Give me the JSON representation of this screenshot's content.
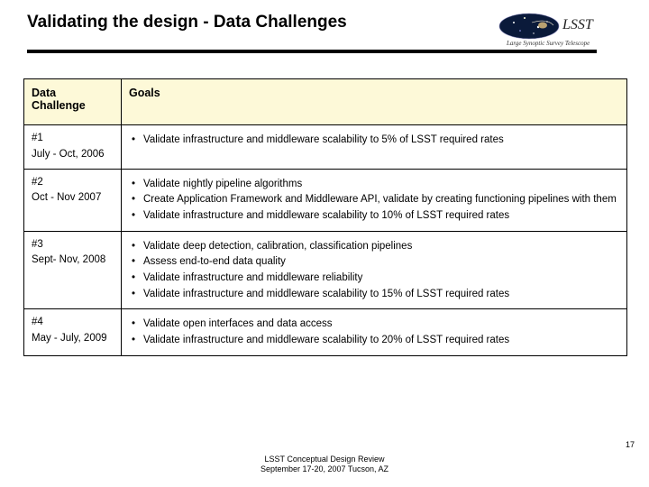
{
  "title": "Validating the design -  Data Challenges",
  "logo": {
    "acronym": "LSST",
    "full": "Large Synoptic Survey Telescope"
  },
  "table": {
    "headers": {
      "col1": "Data\nChallenge",
      "col2": "Goals"
    },
    "rows": [
      {
        "id": "#1",
        "dates": "July - Oct, 2006",
        "goals": [
          "Validate infrastructure and middleware scalability to 5% of LSST required rates"
        ]
      },
      {
        "id": "#2",
        "dates": "Oct - Nov 2007",
        "goals": [
          "Validate nightly pipeline algorithms",
          "Create Application Framework and Middleware API, validate by creating functioning pipelines with them",
          "Validate infrastructure and middleware scalability to 10% of LSST required rates"
        ]
      },
      {
        "id": "#3",
        "dates": "Sept- Nov, 2008",
        "goals": [
          "Validate deep detection, calibration, classification pipelines",
          "Assess end-to-end data quality",
          "Validate infrastructure and  middleware reliability",
          "Validate infrastructure and middleware scalability to 15% of LSST required rates"
        ]
      },
      {
        "id": "#4",
        "dates": "May - July, 2009",
        "goals": [
          "Validate open interfaces and data access",
          "Validate infrastructure and middleware scalability to 20% of LSST required rates"
        ]
      }
    ]
  },
  "footer": {
    "line1": "LSST Conceptual Design Review",
    "line2": "September 17-20, 2007 Tucson, AZ"
  },
  "pagenum": "17"
}
